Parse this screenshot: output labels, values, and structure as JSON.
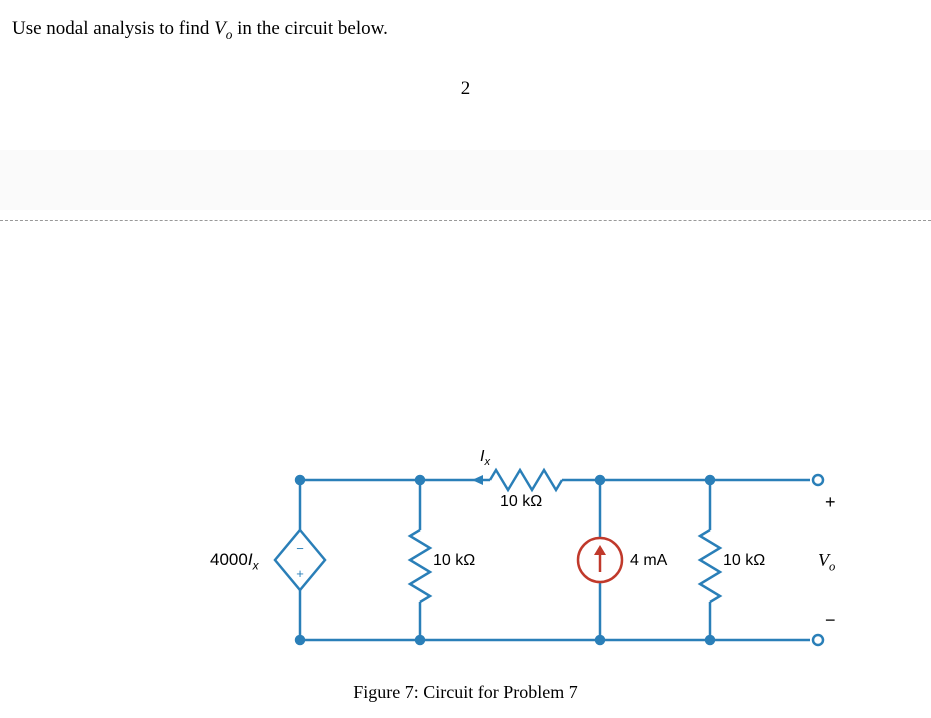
{
  "problem": {
    "text_prefix": "Use nodal analysis to find ",
    "variable_letter": "V",
    "variable_sub": "o",
    "text_suffix": " in the circuit below."
  },
  "page_number": "2",
  "circuit": {
    "dependent_source": {
      "value": "4000",
      "var_letter": "I",
      "var_sub": "x"
    },
    "current_label": {
      "letter": "I",
      "sub": "x"
    },
    "r1_top": "10 kΩ",
    "r2_left": "10 kΩ",
    "r3_right": "10 kΩ",
    "current_source": "4 mA",
    "output": {
      "plus": "+",
      "letter": "V",
      "sub": "o",
      "minus": "−"
    }
  },
  "caption": "Figure 7: Circuit for Problem 7"
}
